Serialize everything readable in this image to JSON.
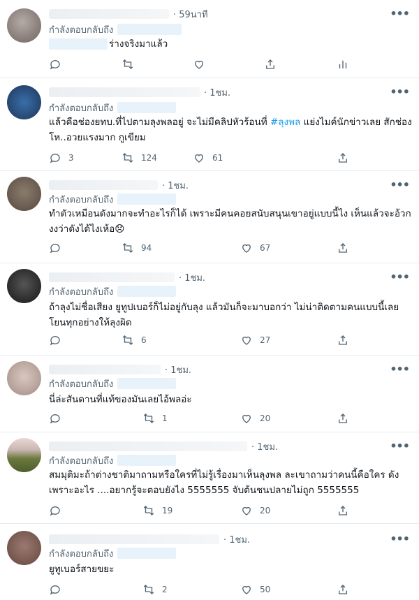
{
  "common": {
    "replying_to": "กำลังตอบกลับถึง",
    "more_icon": "more-horizontal-icon"
  },
  "tweets": [
    {
      "time": "· 59นาที",
      "text": "ร่างจริงมาแล้ว",
      "reply": "",
      "retweet": "",
      "like": "",
      "last_action": "analytics"
    },
    {
      "time": "· 1ชม.",
      "text_prefix": "แล้วคือช่องยทบ.ที่ไปตามลุงพลอยู่ จะไม่มีคลิปหัวร้อนที่ ",
      "hashtag": "#ลุงพล",
      "text_suffix": " แย่งไมค์นักข่าวเลย สักช่อง โห..อวยแรงมาก กูเขียม",
      "reply": "3",
      "retweet": "124",
      "like": "61",
      "last_action": "share"
    },
    {
      "time": "· 1ชม.",
      "text": "ทำตัวเหมือนดังมากจะทำอะไรก็ได้ เพราะมีคนคอยสนับสนุนเขาอยู่แบบนี้ไง เห็นแล้วจะอ้วก งงว่าดังได้ไงเห้อ😞",
      "reply": "",
      "retweet": "94",
      "like": "67",
      "last_action": "share"
    },
    {
      "time": "· 1ชม.",
      "text": "ถ้าลุงไม่ชื่อเสียง ยูทูปเบอร์ก็ไม่อยู่กับลุง แล้วมันก็จะมาบอกว่า ไม่น่าติดตามคนแบบนี้เลย โยนทุกอย่างให้ลุงผิด",
      "reply": "",
      "retweet": "6",
      "like": "27",
      "last_action": "share"
    },
    {
      "time": "· 1ชม.",
      "text": "นี่ล่ะสันดานที่แท้ของมันเลยไอ้พลอ่ะ",
      "reply": "",
      "retweet": "1",
      "like": "20",
      "last_action": "share"
    },
    {
      "time": "· 1ชม.",
      "text": "สมมุติมะถ้าต่างชาติมาถามหรือใครที่ไม่รู้เรื่องมาเห็นลุงพล ละเขาถามว่าคนนี้คือใคร ดังเพราะอะไร ....อยากรู้จะตอบยังไง 5555555 จับต้นชนปลายไม่ถูก 5555555",
      "reply": "",
      "retweet": "19",
      "like": "20",
      "last_action": "share"
    },
    {
      "time": "· 1ชม.",
      "text": "ยูทูเบอร์สายขยะ",
      "reply": "",
      "retweet": "2",
      "like": "50",
      "last_action": "share"
    }
  ],
  "colors": {
    "muted": "#536471",
    "text": "#0f1419",
    "link": "#1d9bf0",
    "divider": "#e6ecf0"
  }
}
